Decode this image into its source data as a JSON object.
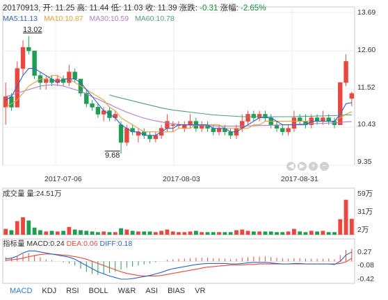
{
  "info": {
    "date": "20170913",
    "open_label": "开:",
    "open": "11.25",
    "high_label": "高:",
    "high": "11.44",
    "low_label": "低:",
    "low": "11.03",
    "close_label": "收:",
    "close": "11.39",
    "change_label": "涨跌:",
    "change": "-0.31",
    "pct_label": "涨幅:",
    "pct": "-2.65%"
  },
  "ma": [
    {
      "label": "MA5:11.13",
      "color": "#2e62c9"
    },
    {
      "label": "MA10:10.87",
      "color": "#e0a040"
    },
    {
      "label": "MA30:10.59",
      "color": "#b07cc6"
    },
    {
      "label": "MA60:10.78",
      "color": "#4fa078"
    }
  ],
  "price_axis": [
    "13.69",
    "12.60",
    "11.52",
    "10.43",
    "9.35"
  ],
  "date_axis": [
    "2017-07-06",
    "2017-08-03",
    "2017-08-31"
  ],
  "annotations": {
    "max": "13.02",
    "min": "9.68"
  },
  "volume": {
    "title": "成交量 量:24.51万",
    "axis": [
      "59万",
      "31万",
      "2万"
    ]
  },
  "indicator": {
    "title": "指标量",
    "macd": "MACD:0.24",
    "dea": "DEA:0.06",
    "diff": "DIFF:0.18",
    "axis": [
      "0.27",
      "-0.08",
      "-0.42"
    ]
  },
  "tabs": [
    "MACD",
    "KDJ",
    "RSI",
    "BOLL",
    "W&R",
    "ASI",
    "BIAS",
    "VR"
  ],
  "zoom_icons": [
    "scroll-left-icon",
    "scroll-right-icon",
    "zoom-in-icon",
    "zoom-out-icon"
  ],
  "colors": {
    "up": "#e8483f",
    "down": "#1f9d55",
    "accent": "#2e7bd6"
  },
  "chart_data": {
    "type": "candlestick",
    "ylim": [
      9.35,
      13.69
    ],
    "candles": [
      [
        11.0,
        11.7,
        10.5,
        11.3
      ],
      [
        11.3,
        11.4,
        10.9,
        11.0
      ],
      [
        11.0,
        12.3,
        11.0,
        12.1
      ],
      [
        12.1,
        12.9,
        11.9,
        12.7
      ],
      [
        12.7,
        13.02,
        12.5,
        12.6
      ],
      [
        12.6,
        12.6,
        11.8,
        11.9
      ],
      [
        11.9,
        12.0,
        11.5,
        11.7
      ],
      [
        11.7,
        11.9,
        11.5,
        11.8
      ],
      [
        11.8,
        11.9,
        11.6,
        11.7
      ],
      [
        11.7,
        11.9,
        11.6,
        11.8
      ],
      [
        11.8,
        11.9,
        11.6,
        11.7
      ],
      [
        11.7,
        12.2,
        11.6,
        12.0
      ],
      [
        12.0,
        12.1,
        11.7,
        11.8
      ],
      [
        11.8,
        11.8,
        11.3,
        11.4
      ],
      [
        11.4,
        11.5,
        11.0,
        11.1
      ],
      [
        11.1,
        11.2,
        10.9,
        11.0
      ],
      [
        11.0,
        11.1,
        10.7,
        10.8
      ],
      [
        10.8,
        11.0,
        10.6,
        10.9
      ],
      [
        10.9,
        11.0,
        10.6,
        10.7
      ],
      [
        10.7,
        10.9,
        10.6,
        10.8
      ],
      [
        10.5,
        10.6,
        9.68,
        10.0
      ],
      [
        10.0,
        10.5,
        9.9,
        10.4
      ],
      [
        10.4,
        10.5,
        10.2,
        10.3
      ],
      [
        10.2,
        10.4,
        10.0,
        10.3
      ],
      [
        10.3,
        10.4,
        10.1,
        10.2
      ],
      [
        10.2,
        10.3,
        10.0,
        10.1
      ],
      [
        10.1,
        10.3,
        10.0,
        10.2
      ],
      [
        10.2,
        10.5,
        10.1,
        10.4
      ],
      [
        10.4,
        10.8,
        10.3,
        10.6
      ],
      [
        10.5,
        10.6,
        10.3,
        10.5
      ],
      [
        10.5,
        10.6,
        10.4,
        10.5
      ],
      [
        10.4,
        10.6,
        10.3,
        10.5
      ],
      [
        10.5,
        10.8,
        10.4,
        10.6
      ],
      [
        10.6,
        10.7,
        10.3,
        10.4
      ],
      [
        10.4,
        10.6,
        10.3,
        10.5
      ],
      [
        10.5,
        10.6,
        10.3,
        10.4
      ],
      [
        10.4,
        10.5,
        10.2,
        10.3
      ],
      [
        10.3,
        10.5,
        10.2,
        10.4
      ],
      [
        10.4,
        10.5,
        10.2,
        10.3
      ],
      [
        10.3,
        10.4,
        10.1,
        10.2
      ],
      [
        10.2,
        10.5,
        10.1,
        10.4
      ],
      [
        10.4,
        10.8,
        10.3,
        10.6
      ],
      [
        10.6,
        10.9,
        10.5,
        10.8
      ],
      [
        10.8,
        10.9,
        10.6,
        10.7
      ],
      [
        10.7,
        10.9,
        10.6,
        10.8
      ],
      [
        10.8,
        10.9,
        10.6,
        10.7
      ],
      [
        10.7,
        10.8,
        10.4,
        10.5
      ],
      [
        10.5,
        10.6,
        10.3,
        10.4
      ],
      [
        10.4,
        10.5,
        10.2,
        10.3
      ],
      [
        10.3,
        10.5,
        10.2,
        10.4
      ],
      [
        10.4,
        10.9,
        10.3,
        10.7
      ],
      [
        10.7,
        10.8,
        10.5,
        10.6
      ],
      [
        10.6,
        10.8,
        10.4,
        10.5
      ],
      [
        10.5,
        10.8,
        10.4,
        10.7
      ],
      [
        10.7,
        10.8,
        10.5,
        10.6
      ],
      [
        10.6,
        10.9,
        10.5,
        10.7
      ],
      [
        10.7,
        10.8,
        10.5,
        10.6
      ],
      [
        10.6,
        10.7,
        10.4,
        10.5
      ],
      [
        10.5,
        11.7,
        10.5,
        11.7
      ],
      [
        11.7,
        12.5,
        11.6,
        12.3
      ],
      [
        11.25,
        11.44,
        11.03,
        11.39
      ]
    ],
    "ma5": [
      11.2,
      11.3,
      11.6,
      11.9,
      12.1,
      12.1,
      12.0,
      11.9,
      11.8,
      11.7,
      11.8,
      11.8,
      11.8,
      11.7,
      11.5,
      11.3,
      11.1,
      10.9,
      10.8,
      10.7,
      10.5,
      10.4,
      10.3,
      10.3,
      10.2,
      10.2,
      10.2,
      10.3,
      10.4,
      10.4,
      10.5,
      10.5,
      10.5,
      10.5,
      10.5,
      10.5,
      10.4,
      10.4,
      10.4,
      10.3,
      10.3,
      10.4,
      10.5,
      10.6,
      10.7,
      10.7,
      10.7,
      10.6,
      10.5,
      10.5,
      10.5,
      10.5,
      10.5,
      10.6,
      10.6,
      10.6,
      10.6,
      10.6,
      10.8,
      11.1,
      11.13
    ],
    "ma10": [
      11.0,
      11.1,
      11.2,
      11.4,
      11.6,
      11.7,
      11.8,
      11.8,
      11.9,
      11.9,
      11.8,
      11.8,
      11.7,
      11.6,
      11.5,
      11.4,
      11.3,
      11.2,
      11.0,
      10.9,
      10.7,
      10.6,
      10.5,
      10.4,
      10.3,
      10.3,
      10.3,
      10.3,
      10.3,
      10.3,
      10.4,
      10.4,
      10.4,
      10.5,
      10.5,
      10.5,
      10.5,
      10.5,
      10.4,
      10.4,
      10.4,
      10.4,
      10.4,
      10.5,
      10.5,
      10.6,
      10.6,
      10.6,
      10.6,
      10.6,
      10.6,
      10.6,
      10.6,
      10.6,
      10.6,
      10.6,
      10.6,
      10.6,
      10.7,
      10.8,
      10.87
    ],
    "ma30": [
      11.3,
      11.35,
      11.4,
      11.45,
      11.5,
      11.55,
      11.6,
      11.62,
      11.64,
      11.63,
      11.6,
      11.55,
      11.5,
      11.45,
      11.38,
      11.3,
      11.23,
      11.15,
      11.08,
      11.0,
      10.93,
      10.86,
      10.8,
      10.74,
      10.69,
      10.65,
      10.61,
      10.58,
      10.55,
      10.53,
      10.51,
      10.5,
      10.49,
      10.48,
      10.48,
      10.47,
      10.47,
      10.46,
      10.46,
      10.46,
      10.46,
      10.46,
      10.47,
      10.47,
      10.48,
      10.48,
      10.49,
      10.49,
      10.5,
      10.5,
      10.51,
      10.52,
      10.52,
      10.53,
      10.54,
      10.54,
      10.55,
      10.56,
      10.57,
      10.58,
      10.59
    ],
    "ma60": [
      null,
      null,
      null,
      null,
      null,
      null,
      null,
      null,
      null,
      null,
      null,
      null,
      null,
      null,
      null,
      null,
      null,
      null,
      11.35,
      11.3,
      11.26,
      11.22,
      11.18,
      11.14,
      11.1,
      11.06,
      11.02,
      10.98,
      10.95,
      10.92,
      10.9,
      10.88,
      10.86,
      10.84,
      10.82,
      10.8,
      10.78,
      10.77,
      10.76,
      10.75,
      10.74,
      10.73,
      10.73,
      10.73,
      10.73,
      10.73,
      10.73,
      10.73,
      10.73,
      10.73,
      10.73,
      10.74,
      10.74,
      10.74,
      10.75,
      10.75,
      10.76,
      10.76,
      10.77,
      10.78,
      10.78
    ],
    "volume_ylim": [
      0,
      59
    ],
    "volume": [
      9,
      7,
      21,
      27,
      22,
      11,
      7,
      5,
      6,
      5,
      6,
      12,
      8,
      7,
      6,
      5,
      4,
      5,
      4,
      4,
      10,
      8,
      6,
      5,
      5,
      5,
      4,
      6,
      8,
      5,
      4,
      4,
      5,
      6,
      4,
      4,
      4,
      4,
      4,
      4,
      7,
      8,
      6,
      5,
      5,
      5,
      5,
      4,
      4,
      5,
      9,
      5,
      4,
      6,
      5,
      6,
      4,
      4,
      24,
      54,
      24.51
    ],
    "macd_ylim": [
      -0.42,
      0.27
    ],
    "macd_hist": [
      0.08,
      0.07,
      0.1,
      0.14,
      0.16,
      0.12,
      0.08,
      0.04,
      0.02,
      0.0,
      -0.02,
      -0.04,
      -0.08,
      -0.14,
      -0.2,
      -0.24,
      -0.26,
      -0.24,
      -0.22,
      -0.2,
      -0.16,
      -0.12,
      -0.1,
      -0.08,
      -0.06,
      -0.04,
      -0.02,
      0.0,
      0.03,
      0.04,
      0.05,
      0.05,
      0.06,
      0.07,
      0.07,
      0.07,
      0.06,
      0.06,
      0.05,
      0.04,
      0.05,
      0.07,
      0.08,
      0.09,
      0.09,
      0.09,
      0.08,
      0.07,
      0.06,
      0.05,
      0.06,
      0.06,
      0.05,
      0.05,
      0.05,
      0.05,
      0.05,
      0.04,
      0.12,
      0.22,
      0.24
    ],
    "dif": [
      0.05,
      0.06,
      0.1,
      0.16,
      0.2,
      0.2,
      0.18,
      0.16,
      0.14,
      0.12,
      0.1,
      0.08,
      0.04,
      -0.02,
      -0.08,
      -0.14,
      -0.2,
      -0.24,
      -0.28,
      -0.31,
      -0.34,
      -0.34,
      -0.33,
      -0.31,
      -0.29,
      -0.27,
      -0.24,
      -0.21,
      -0.17,
      -0.14,
      -0.12,
      -0.1,
      -0.08,
      -0.06,
      -0.05,
      -0.04,
      -0.04,
      -0.04,
      -0.04,
      -0.05,
      -0.05,
      -0.04,
      -0.03,
      -0.02,
      -0.02,
      -0.02,
      -0.03,
      -0.04,
      -0.05,
      -0.05,
      -0.04,
      -0.04,
      -0.05,
      -0.05,
      -0.05,
      -0.05,
      -0.05,
      -0.06,
      0.0,
      0.12,
      0.18
    ],
    "dea": [
      0.02,
      0.03,
      0.04,
      0.06,
      0.09,
      0.11,
      0.13,
      0.14,
      0.14,
      0.13,
      0.12,
      0.11,
      0.09,
      0.07,
      0.04,
      0.0,
      -0.04,
      -0.08,
      -0.12,
      -0.16,
      -0.2,
      -0.23,
      -0.25,
      -0.27,
      -0.28,
      -0.28,
      -0.28,
      -0.27,
      -0.25,
      -0.23,
      -0.21,
      -0.19,
      -0.17,
      -0.15,
      -0.13,
      -0.11,
      -0.1,
      -0.09,
      -0.08,
      -0.07,
      -0.07,
      -0.07,
      -0.06,
      -0.06,
      -0.05,
      -0.05,
      -0.05,
      -0.05,
      -0.05,
      -0.05,
      -0.05,
      -0.05,
      -0.05,
      -0.05,
      -0.05,
      -0.05,
      -0.05,
      -0.05,
      -0.04,
      -0.01,
      0.06
    ]
  }
}
